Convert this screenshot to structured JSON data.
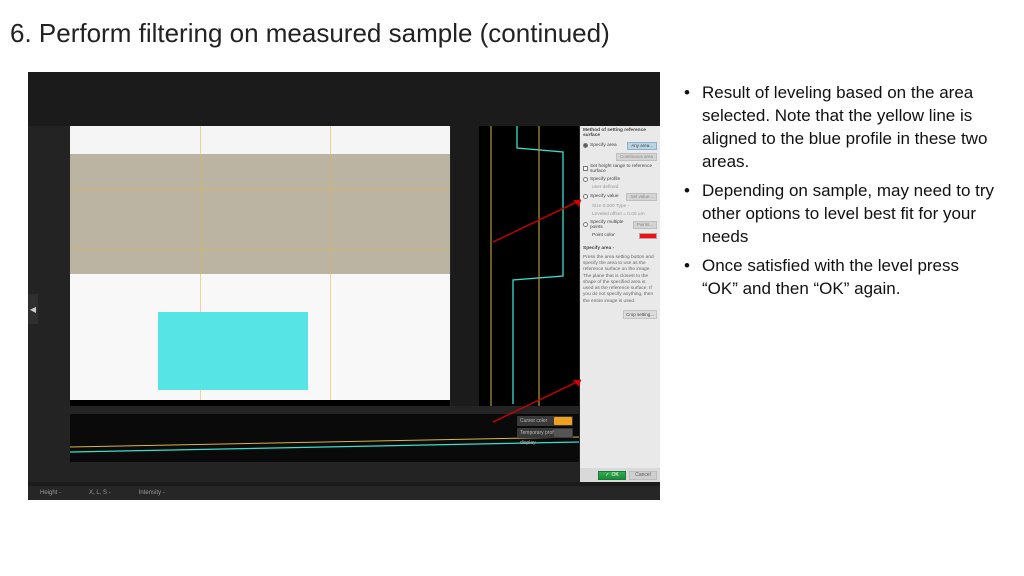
{
  "title": "6. Perform filtering on measured sample (continued)",
  "notes": [
    "Result of leveling based on the area selected.  Note that the yellow line is aligned to the blue profile in these two areas.",
    "Depending on sample, may need to try other options to level best fit for your needs",
    "Once satisfied with the level press “OK” and then “OK” again."
  ],
  "panel": {
    "header": "Method of setting reference surface",
    "opt_area": "Specify area",
    "btn_any_area": "Any area...",
    "btn_continuous": "Continuous area",
    "chk_height": "Set height range to reference surface",
    "opt_profile": "Specify profile",
    "profile_sub": "user defined",
    "opt_value": "Specify value",
    "btn_set_value": "Set value...",
    "value_detail": "Size  0.000  Type  -",
    "value_detail2": "Leveled offset = 0.00 um",
    "opt_multi": "Specify multiple points",
    "btn_points": "Points...",
    "point_color": "Point color",
    "spec_hdr": "Specify area -",
    "spec_para": "Press the area setting button and specify the area to use as the reference surface on the image.\nThe plane that is closest to the shape of the specified area is used as the reference surface.\nIf you do not specify anything, then the entire image is used.",
    "btn_crop": "Crop setting...",
    "ok": "OK",
    "cancel": "Cancel"
  },
  "profctrl": {
    "cursor": "Cursor color",
    "temp": "Temporary profile display"
  },
  "status": {
    "height": "Height  -",
    "xls": "X, L, S  -",
    "intensity": "Intensity  -"
  },
  "icons": {
    "flyout": "◀",
    "check": "✓"
  }
}
